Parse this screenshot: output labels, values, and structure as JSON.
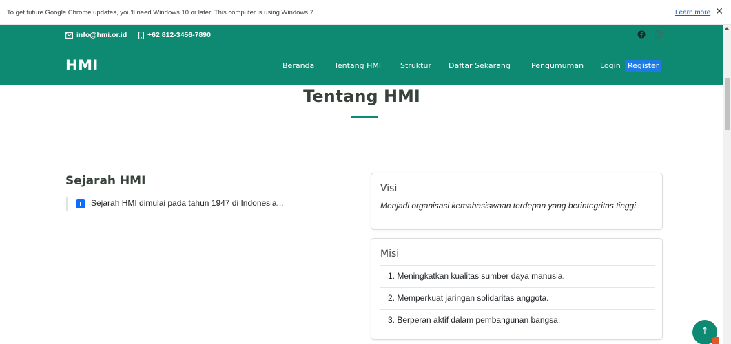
{
  "infobar": {
    "message": "To get future Google Chrome updates, you’ll need Windows 10 or later. This computer is using Windows 7.",
    "learn_more": "Learn more",
    "close_glyph": "✕"
  },
  "header": {
    "email": "info@hmi.or.id",
    "phone": "+62 812-3456-7890",
    "logo": "HMI",
    "nav": [
      "Beranda",
      "Tentang HMI",
      "Struktur",
      "Daftar Sekarang",
      "Pengumuman",
      "Login",
      "Register"
    ],
    "social_icons": [
      "facebook-icon",
      "instagram-icon"
    ],
    "brand_color": "#0f8a72",
    "register_color": "#1e7be6"
  },
  "section": {
    "title": "Tentang HMI"
  },
  "history": {
    "title": "Sejarah HMI",
    "text": "Sejarah HMI dimulai pada tahun 1947 di Indonesia..."
  },
  "visi": {
    "title": "Visi",
    "text": "Menjadi organisasi kemahasiswaan terdepan yang berintegritas tinggi."
  },
  "misi": {
    "title": "Misi",
    "items": [
      "1. Meningkatkan kualitas sumber daya manusia.",
      "2. Memperkuat jaringan solidaritas anggota.",
      "3. Berperan aktif dalam pembangunan bangsa."
    ]
  },
  "back_to_top": {
    "glyph": "↑"
  }
}
